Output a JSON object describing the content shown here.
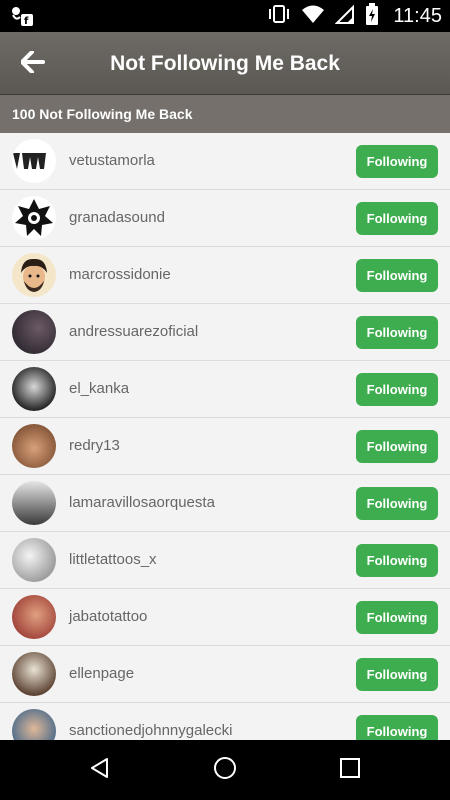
{
  "status_bar": {
    "time": "11:45",
    "left_icons": [
      "app-notification-icon"
    ],
    "right_icons": [
      "vibrate-icon",
      "wifi-icon",
      "signal-icon",
      "battery-charging-icon"
    ]
  },
  "toolbar": {
    "back_icon": "back-arrow-icon",
    "title": "Not Following Me Back"
  },
  "subheader": {
    "text": "100 Not Following Me Back"
  },
  "list": {
    "button_label": "Following",
    "button_color": "#3ead4f",
    "items": [
      {
        "username": "vetustamorla",
        "avatar": "vm-logo"
      },
      {
        "username": "granadasound",
        "avatar": "star-logo"
      },
      {
        "username": "marcrossidonie",
        "avatar": "cartoon-face"
      },
      {
        "username": "andressuarezoficial",
        "avatar": "photo-dark"
      },
      {
        "username": "el_kanka",
        "avatar": "photo-bw"
      },
      {
        "username": "redry13",
        "avatar": "photo-face-warm"
      },
      {
        "username": "lamaravillosaorquesta",
        "avatar": "photo-group"
      },
      {
        "username": "littletattoos_x",
        "avatar": "photo-light"
      },
      {
        "username": "jabatotattoo",
        "avatar": "photo-face"
      },
      {
        "username": "ellenpage",
        "avatar": "photo-mask"
      },
      {
        "username": "sanctionedjohnnygalecki",
        "avatar": "photo-face-blue"
      }
    ]
  },
  "nav_bar": {
    "icons": [
      "back-triangle-icon",
      "home-circle-icon",
      "recents-square-icon"
    ]
  }
}
